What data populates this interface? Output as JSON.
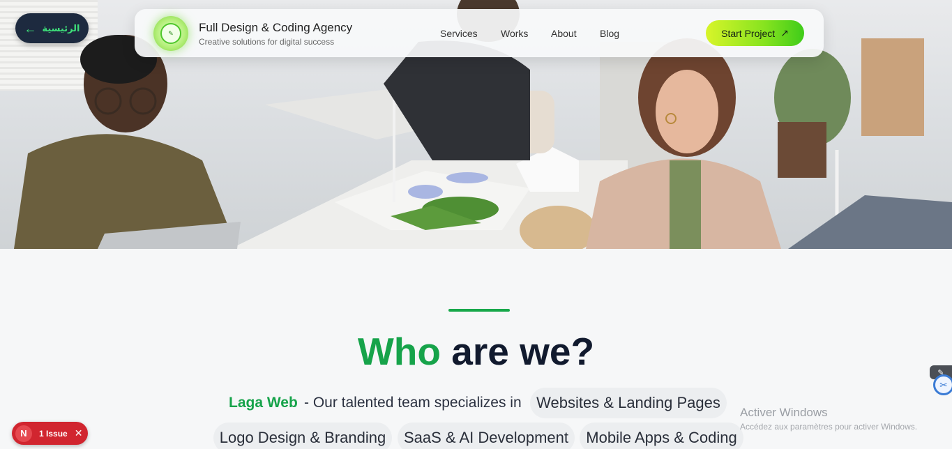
{
  "back_button": {
    "label": "الرئيسية",
    "icon": "arrow-left-icon"
  },
  "nav": {
    "brand_title": "Full Design & Coding Agency",
    "brand_subtitle": "Creative solutions for digital success",
    "logo_icon": "agency-logo-icon",
    "links": [
      "Services",
      "Works",
      "About",
      "Blog"
    ],
    "cta_label": "Start Project",
    "cta_icon": "arrow-up-right-icon"
  },
  "section": {
    "headline_green": "Who",
    "headline_rest": "are we?",
    "brand_name": "Laga Web",
    "intro": "- Our talented team specializes in",
    "services": [
      "Websites & Landing Pages",
      "Logo Design & Branding",
      "SaaS & AI Development",
      "Mobile Apps & Coding"
    ]
  },
  "windows_watermark": {
    "title": "Activer Windows",
    "subtitle": "Accédez aux paramètres pour activer Windows."
  },
  "issue_badge": {
    "letter": "N",
    "label": "1 Issue"
  },
  "colors": {
    "accent_green": "#16a34a",
    "dark_navy": "#111a2e",
    "cta_start": "#d8f52a",
    "cta_end": "#3fcc1a",
    "issue_red": "#d1252f"
  }
}
